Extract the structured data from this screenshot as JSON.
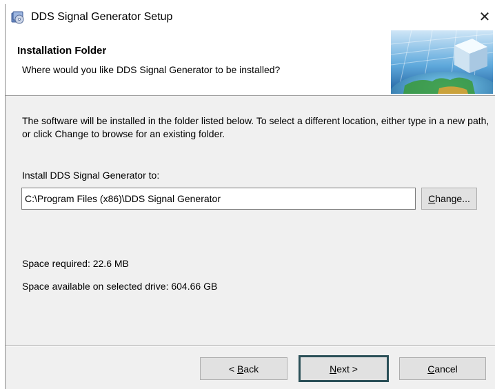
{
  "window": {
    "title": "DDS Signal Generator Setup",
    "close_glyph": "✕"
  },
  "header": {
    "title": "Installation Folder",
    "subtitle": "Where would you like DDS Signal Generator to be installed?"
  },
  "body": {
    "description": "The software will be installed in the folder listed below. To select a different location, either type in a new path, or click Change to browse for an existing folder.",
    "install_label": "Install DDS Signal Generator to:",
    "install_path": "C:\\Program Files (x86)\\DDS Signal Generator",
    "change_button": {
      "mnemonic": "C",
      "rest": "hange..."
    },
    "space_required": "Space required: 22.6 MB",
    "space_available": "Space available on selected drive: 604.66 GB"
  },
  "footer": {
    "back_button": {
      "prefix": "< ",
      "mnemonic": "B",
      "rest": "ack"
    },
    "next_button": {
      "mnemonic": "N",
      "rest": "ext >"
    },
    "cancel_button": {
      "mnemonic": "C",
      "rest": "ancel"
    }
  },
  "colors": {
    "dialog_background": "#f0f0f0",
    "default_button_border": "#2a4f57"
  },
  "icons": {
    "title_icon": "installer-disc-icon",
    "header_graphic": "globe-cube-graphic"
  }
}
